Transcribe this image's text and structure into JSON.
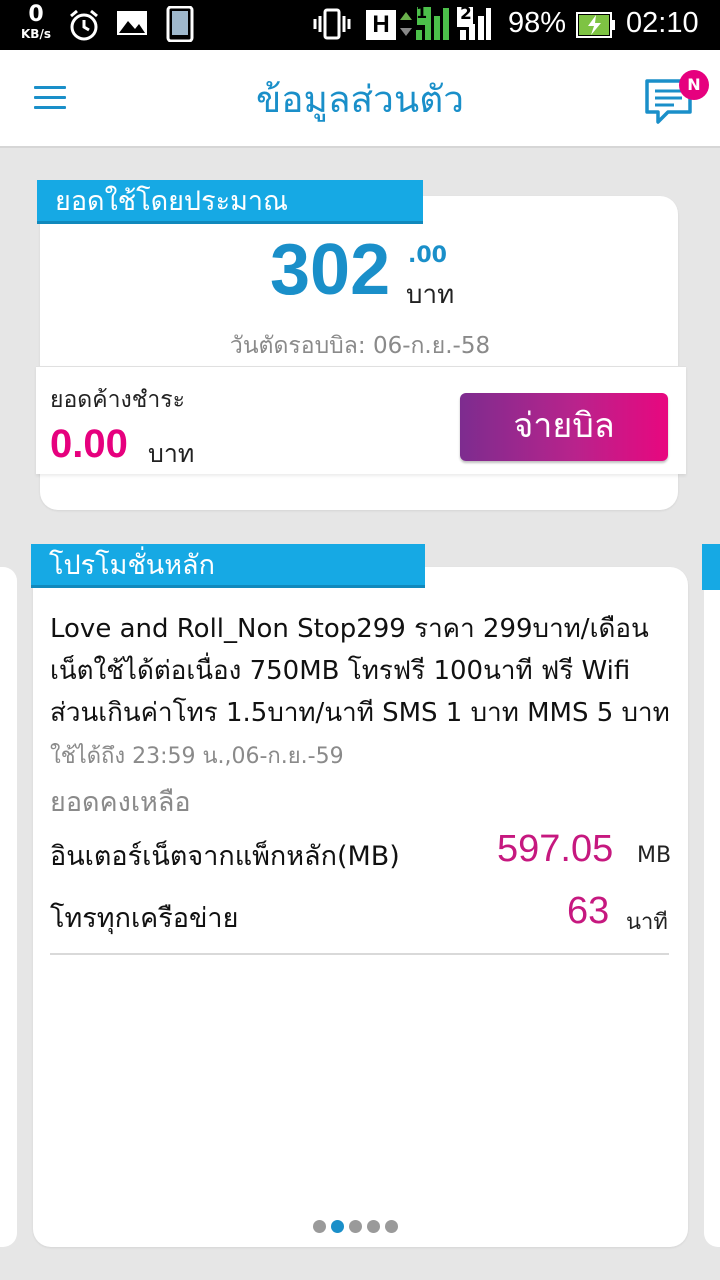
{
  "status_bar": {
    "net_speed": "0",
    "net_unit": "KB/s",
    "network_type": "H",
    "sim1": "1",
    "sim2": "2",
    "battery": "98%",
    "time": "02:10",
    "icons": [
      "alarm-clock-icon",
      "image-icon",
      "phone-icon",
      "vibrate-icon",
      "network-h-icon",
      "signal-sim1-icon",
      "signal-sim2-icon",
      "battery-charging-icon"
    ]
  },
  "header": {
    "title": "ข้อมูลส่วนตัว",
    "badge": "N",
    "icons": [
      "hamburger-menu-icon",
      "message-icon"
    ]
  },
  "usage": {
    "tab_label": "ยอดใช้โดยประมาณ",
    "amount": "302",
    "decimal": ".00",
    "unit": "บาท",
    "bill_cut_date": "วันตัดรอบบิล: 06-ก.ย.-58"
  },
  "outstanding": {
    "label": "ยอดค้างชำระ",
    "amount": "0.00",
    "unit": "บาท",
    "pay_button": "จ่ายบิล"
  },
  "promotion": {
    "tab_label": "โปรโมชั่นหลัก",
    "description_lines": [
      "Love and Roll_Non Stop299 ราคา 299บาท/เดือน",
      "เน็ตใช้ได้ต่อเนื่อง 750MB โทรฟรี 100นาที ฟรี Wifi",
      "ส่วนเกินค่าโทร 1.5บาท/นาที SMS 1 บาท MMS 5 บาท"
    ],
    "valid_until": "ใช้ได้ถึง 23:59 น.,06-ก.ย.-59",
    "remaining_label": "ยอดคงเหลือ",
    "rows": [
      {
        "label": "อินเตอร์เน็ตจากแพ็กหลัก(MB)",
        "value": "597.05",
        "unit": "MB"
      },
      {
        "label": "โทรทุกเครือข่าย",
        "value": "63",
        "unit": "นาที"
      }
    ]
  },
  "pager": {
    "count": 5,
    "active_index": 1
  },
  "colors": {
    "accent_blue": "#1a8fc9",
    "tab_blue": "#16a9e4",
    "magenta": "#e6007e",
    "pay_gradient_start": "#7d2c8f",
    "pay_gradient_end": "#e8077f"
  }
}
